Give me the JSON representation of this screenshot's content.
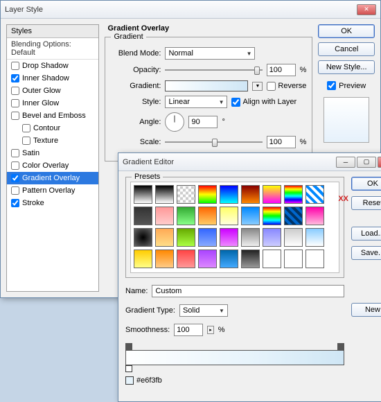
{
  "layerStyle": {
    "title": "Layer Style",
    "stylesHeader": "Styles",
    "blendingOptions": "Blending Options: Default",
    "items": [
      {
        "label": "Drop Shadow",
        "checked": false,
        "selected": false,
        "indent": false
      },
      {
        "label": "Inner Shadow",
        "checked": true,
        "selected": false,
        "indent": false
      },
      {
        "label": "Outer Glow",
        "checked": false,
        "selected": false,
        "indent": false
      },
      {
        "label": "Inner Glow",
        "checked": false,
        "selected": false,
        "indent": false
      },
      {
        "label": "Bevel and Emboss",
        "checked": false,
        "selected": false,
        "indent": false
      },
      {
        "label": "Contour",
        "checked": false,
        "selected": false,
        "indent": true
      },
      {
        "label": "Texture",
        "checked": false,
        "selected": false,
        "indent": true
      },
      {
        "label": "Satin",
        "checked": false,
        "selected": false,
        "indent": false
      },
      {
        "label": "Color Overlay",
        "checked": false,
        "selected": false,
        "indent": false
      },
      {
        "label": "Gradient Overlay",
        "checked": true,
        "selected": true,
        "indent": false
      },
      {
        "label": "Pattern Overlay",
        "checked": false,
        "selected": false,
        "indent": false
      },
      {
        "label": "Stroke",
        "checked": true,
        "selected": false,
        "indent": false
      }
    ],
    "section": {
      "title": "Gradient Overlay",
      "groupTitle": "Gradient",
      "blendModeLabel": "Blend Mode:",
      "blendModeValue": "Normal",
      "opacityLabel": "Opacity:",
      "opacityValue": "100",
      "opacityUnit": "%",
      "gradientLabel": "Gradient:",
      "reverseLabel": "Reverse",
      "styleLabel": "Style:",
      "styleValue": "Linear",
      "alignLabel": "Align with Layer",
      "alignChecked": true,
      "angleLabel": "Angle:",
      "angleValue": "90",
      "angleUnit": "°",
      "scaleLabel": "Scale:",
      "scaleValue": "100",
      "scaleUnit": "%"
    },
    "buttons": {
      "ok": "OK",
      "cancel": "Cancel",
      "newStyle": "New Style...",
      "previewLabel": "Preview",
      "previewChecked": true
    }
  },
  "gradientEditor": {
    "title": "Gradient Editor",
    "presetsLabel": "Presets",
    "swatches": [
      "linear-gradient(#000,#fff)",
      "linear-gradient(#000,transparent)",
      "repeating-conic-gradient(#ccc 0 25%,#fff 0 50%) 0/8px 8px",
      "linear-gradient(#f00,#ff0,#0f0)",
      "linear-gradient(#00f,#0ff)",
      "linear-gradient(#800,#f80)",
      "linear-gradient(#ff0,#f0f)",
      "linear-gradient(#f00,#ff0,#0f0,#0ff,#00f,#f0f)",
      "repeating-linear-gradient(45deg,#08f 0 4px,#fff 0 8px)",
      "linear-gradient(#333,#555)",
      "linear-gradient(#f99,#fcc)",
      "linear-gradient(#3a3,#8f8)",
      "linear-gradient(#f60,#fc6)",
      "linear-gradient(#ff6,#ffd)",
      "linear-gradient(#08f,#8cf)",
      "linear-gradient(#f00,#ff0,#0f0,#0ff,#00f)",
      "repeating-linear-gradient(45deg,#036 0 4px,#06c 0 8px)",
      "linear-gradient(#f0a,#fbd)",
      "radial-gradient(#000,#666)",
      "linear-gradient(#fa5,#fd8)",
      "linear-gradient(#6a0,#af4)",
      "linear-gradient(#36f,#8af)",
      "linear-gradient(#c0f,#e8f)",
      "linear-gradient(#888,#eee)",
      "linear-gradient(#88f,#ccf)",
      "linear-gradient(#ccc,#fff)",
      "linear-gradient(#8cf,#fff)",
      "linear-gradient(#fc0,#ff8)",
      "linear-gradient(#f80,#fc8)",
      "linear-gradient(#f44,#f99)",
      "linear-gradient(#a4f,#d8f)",
      "linear-gradient(#06a,#4af)",
      "linear-gradient(#222,#999)",
      "linear-gradient(#fff,#fff)",
      "linear-gradient(#fff,#fff)",
      "linear-gradient(#fff,#fff)"
    ],
    "nameLabel": "Name:",
    "nameValue": "Custom",
    "gradTypeLabel": "Gradient Type:",
    "gradTypeValue": "Solid",
    "smoothLabel": "Smoothness:",
    "smoothValue": "100",
    "smoothUnit": "%",
    "hex": "#e6f3fb",
    "buttons": {
      "ok": "OK",
      "reset": "Reset",
      "load": "Load...",
      "save": "Save...",
      "new": "New"
    },
    "annotation": "XX"
  }
}
